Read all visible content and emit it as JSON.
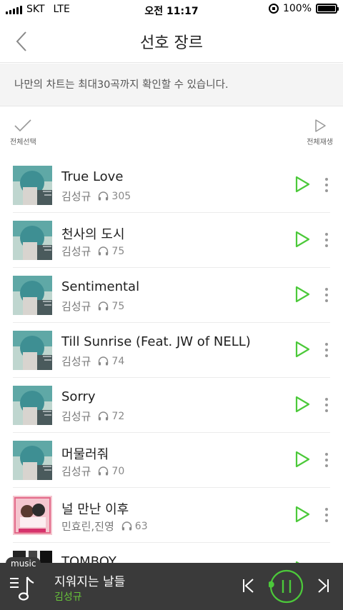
{
  "status_bar": {
    "carrier": "SKT",
    "network": "LTE",
    "time": "오전 11:17",
    "battery": "100%",
    "battery_level": 1.0
  },
  "header": {
    "title": "선호 장르",
    "back_icon": "chevron-left-icon"
  },
  "info": {
    "text": "나만의 차트는 최대30곡까지 확인할 수 있습니다."
  },
  "toolbar": {
    "select_all_label": "전체선택",
    "play_all_label": "전체재생"
  },
  "songs": [
    {
      "title": "True Love",
      "artist": "김성규",
      "plays": "305",
      "art": "teal"
    },
    {
      "title": "천사의 도시",
      "artist": "김성규",
      "plays": "75",
      "art": "teal"
    },
    {
      "title": "Sentimental",
      "artist": "김성규",
      "plays": "75",
      "art": "teal"
    },
    {
      "title": "Till Sunrise (Feat. JW of NELL)",
      "artist": "김성규",
      "plays": "74",
      "art": "teal"
    },
    {
      "title": "Sorry",
      "artist": "김성규",
      "plays": "72",
      "art": "teal"
    },
    {
      "title": "머물러줘",
      "artist": "김성규",
      "plays": "70",
      "art": "teal"
    },
    {
      "title": "널 만난 이후",
      "artist": "민효린,진영",
      "plays": "63",
      "art": "pink"
    },
    {
      "title": "TOMBOY",
      "artist": "",
      "plays": "",
      "art": "mono"
    }
  ],
  "player": {
    "tag": "music",
    "title": "지워지는 날들",
    "artist": "김성규",
    "progress": 0.02
  },
  "colors": {
    "accent_green": "#4cc93a",
    "player_bg": "#3a3a3a",
    "player_artist": "#67c23a"
  }
}
